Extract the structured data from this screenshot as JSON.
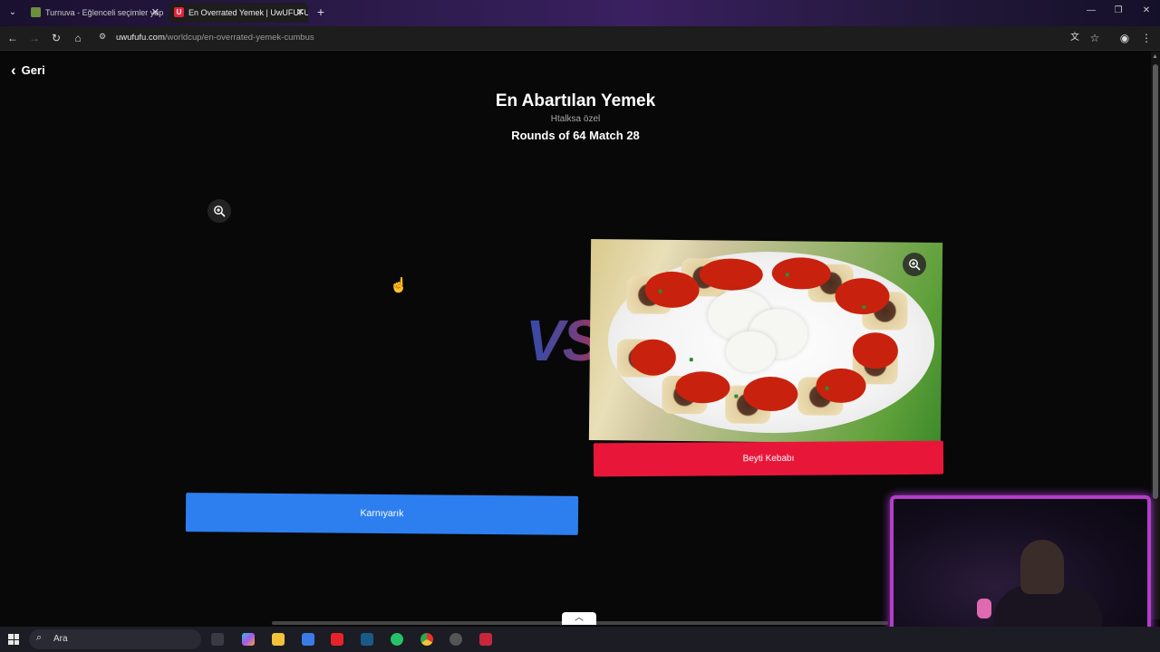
{
  "browser": {
    "tabs": [
      {
        "title": "Turnuva - Eğlenceli seçimler yap",
        "active": false
      },
      {
        "title": "En Overrated Yemek | UwUFUFU",
        "active": true
      }
    ],
    "url_host": "uwufufu.com",
    "url_path": "/worldcup/en-overrated-yemek-cumbus"
  },
  "page": {
    "back_label": "Geri",
    "title": "En Abartılan Yemek",
    "subtitle": "Htalksa özel",
    "round_info": "Rounds of 64 Match 28",
    "vs_label": "VS",
    "choices": {
      "left": {
        "label": "Karnıyarık",
        "color": "#2d7ff0"
      },
      "right": {
        "label": "Beyti Kebabı",
        "color": "#e8173a"
      }
    }
  },
  "taskbar": {
    "search_placeholder": "Ara"
  }
}
